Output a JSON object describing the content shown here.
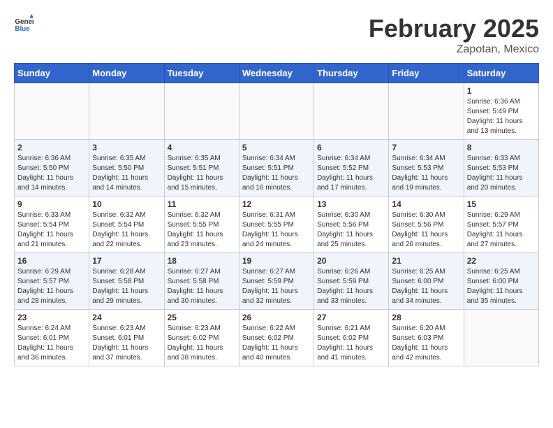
{
  "header": {
    "logo_general": "General",
    "logo_blue": "Blue",
    "month_title": "February 2025",
    "location": "Zapotan, Mexico"
  },
  "days_of_week": [
    "Sunday",
    "Monday",
    "Tuesday",
    "Wednesday",
    "Thursday",
    "Friday",
    "Saturday"
  ],
  "weeks": [
    [
      {
        "day": "",
        "sunrise": "",
        "sunset": "",
        "daylight": ""
      },
      {
        "day": "",
        "sunrise": "",
        "sunset": "",
        "daylight": ""
      },
      {
        "day": "",
        "sunrise": "",
        "sunset": "",
        "daylight": ""
      },
      {
        "day": "",
        "sunrise": "",
        "sunset": "",
        "daylight": ""
      },
      {
        "day": "",
        "sunrise": "",
        "sunset": "",
        "daylight": ""
      },
      {
        "day": "",
        "sunrise": "",
        "sunset": "",
        "daylight": ""
      },
      {
        "day": "1",
        "sunrise": "Sunrise: 6:36 AM",
        "sunset": "Sunset: 5:49 PM",
        "daylight": "Daylight: 11 hours and 13 minutes."
      }
    ],
    [
      {
        "day": "2",
        "sunrise": "Sunrise: 6:36 AM",
        "sunset": "Sunset: 5:50 PM",
        "daylight": "Daylight: 11 hours and 14 minutes."
      },
      {
        "day": "3",
        "sunrise": "Sunrise: 6:35 AM",
        "sunset": "Sunset: 5:50 PM",
        "daylight": "Daylight: 11 hours and 14 minutes."
      },
      {
        "day": "4",
        "sunrise": "Sunrise: 6:35 AM",
        "sunset": "Sunset: 5:51 PM",
        "daylight": "Daylight: 11 hours and 15 minutes."
      },
      {
        "day": "5",
        "sunrise": "Sunrise: 6:34 AM",
        "sunset": "Sunset: 5:51 PM",
        "daylight": "Daylight: 11 hours and 16 minutes."
      },
      {
        "day": "6",
        "sunrise": "Sunrise: 6:34 AM",
        "sunset": "Sunset: 5:52 PM",
        "daylight": "Daylight: 11 hours and 17 minutes."
      },
      {
        "day": "7",
        "sunrise": "Sunrise: 6:34 AM",
        "sunset": "Sunset: 5:53 PM",
        "daylight": "Daylight: 11 hours and 19 minutes."
      },
      {
        "day": "8",
        "sunrise": "Sunrise: 6:33 AM",
        "sunset": "Sunset: 5:53 PM",
        "daylight": "Daylight: 11 hours and 20 minutes."
      }
    ],
    [
      {
        "day": "9",
        "sunrise": "Sunrise: 6:33 AM",
        "sunset": "Sunset: 5:54 PM",
        "daylight": "Daylight: 11 hours and 21 minutes."
      },
      {
        "day": "10",
        "sunrise": "Sunrise: 6:32 AM",
        "sunset": "Sunset: 5:54 PM",
        "daylight": "Daylight: 11 hours and 22 minutes."
      },
      {
        "day": "11",
        "sunrise": "Sunrise: 6:32 AM",
        "sunset": "Sunset: 5:55 PM",
        "daylight": "Daylight: 11 hours and 23 minutes."
      },
      {
        "day": "12",
        "sunrise": "Sunrise: 6:31 AM",
        "sunset": "Sunset: 5:55 PM",
        "daylight": "Daylight: 11 hours and 24 minutes."
      },
      {
        "day": "13",
        "sunrise": "Sunrise: 6:30 AM",
        "sunset": "Sunset: 5:56 PM",
        "daylight": "Daylight: 11 hours and 25 minutes."
      },
      {
        "day": "14",
        "sunrise": "Sunrise: 6:30 AM",
        "sunset": "Sunset: 5:56 PM",
        "daylight": "Daylight: 11 hours and 26 minutes."
      },
      {
        "day": "15",
        "sunrise": "Sunrise: 6:29 AM",
        "sunset": "Sunset: 5:57 PM",
        "daylight": "Daylight: 11 hours and 27 minutes."
      }
    ],
    [
      {
        "day": "16",
        "sunrise": "Sunrise: 6:29 AM",
        "sunset": "Sunset: 5:57 PM",
        "daylight": "Daylight: 11 hours and 28 minutes."
      },
      {
        "day": "17",
        "sunrise": "Sunrise: 6:28 AM",
        "sunset": "Sunset: 5:58 PM",
        "daylight": "Daylight: 11 hours and 29 minutes."
      },
      {
        "day": "18",
        "sunrise": "Sunrise: 6:27 AM",
        "sunset": "Sunset: 5:58 PM",
        "daylight": "Daylight: 11 hours and 30 minutes."
      },
      {
        "day": "19",
        "sunrise": "Sunrise: 6:27 AM",
        "sunset": "Sunset: 5:59 PM",
        "daylight": "Daylight: 11 hours and 32 minutes."
      },
      {
        "day": "20",
        "sunrise": "Sunrise: 6:26 AM",
        "sunset": "Sunset: 5:59 PM",
        "daylight": "Daylight: 11 hours and 33 minutes."
      },
      {
        "day": "21",
        "sunrise": "Sunrise: 6:25 AM",
        "sunset": "Sunset: 6:00 PM",
        "daylight": "Daylight: 11 hours and 34 minutes."
      },
      {
        "day": "22",
        "sunrise": "Sunrise: 6:25 AM",
        "sunset": "Sunset: 6:00 PM",
        "daylight": "Daylight: 11 hours and 35 minutes."
      }
    ],
    [
      {
        "day": "23",
        "sunrise": "Sunrise: 6:24 AM",
        "sunset": "Sunset: 6:01 PM",
        "daylight": "Daylight: 11 hours and 36 minutes."
      },
      {
        "day": "24",
        "sunrise": "Sunrise: 6:23 AM",
        "sunset": "Sunset: 6:01 PM",
        "daylight": "Daylight: 11 hours and 37 minutes."
      },
      {
        "day": "25",
        "sunrise": "Sunrise: 6:23 AM",
        "sunset": "Sunset: 6:02 PM",
        "daylight": "Daylight: 11 hours and 38 minutes."
      },
      {
        "day": "26",
        "sunrise": "Sunrise: 6:22 AM",
        "sunset": "Sunset: 6:02 PM",
        "daylight": "Daylight: 11 hours and 40 minutes."
      },
      {
        "day": "27",
        "sunrise": "Sunrise: 6:21 AM",
        "sunset": "Sunset: 6:02 PM",
        "daylight": "Daylight: 11 hours and 41 minutes."
      },
      {
        "day": "28",
        "sunrise": "Sunrise: 6:20 AM",
        "sunset": "Sunset: 6:03 PM",
        "daylight": "Daylight: 11 hours and 42 minutes."
      },
      {
        "day": "",
        "sunrise": "",
        "sunset": "",
        "daylight": ""
      }
    ]
  ]
}
